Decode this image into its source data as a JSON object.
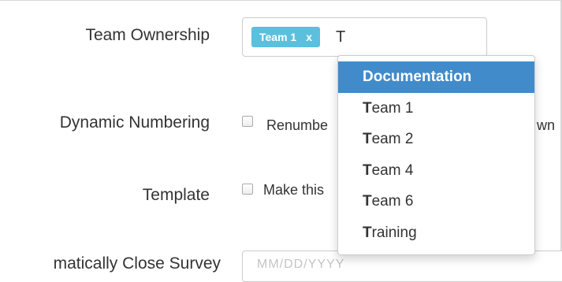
{
  "form": {
    "team_ownership": {
      "label": "Team Ownership",
      "token_label": "Team 1",
      "token_remove": "x",
      "typed_value": "T"
    },
    "dynamic_numbering": {
      "label": "Dynamic Numbering",
      "checkbox_text_left": "Renumbe",
      "checkbox_text_right": "wn",
      "checked": false
    },
    "template": {
      "label": "Template",
      "checkbox_text": "Make this",
      "checked": false
    },
    "auto_close": {
      "label": "matically Close Survey",
      "field_value": "MM/DD/YYYY"
    }
  },
  "dropdown": {
    "query": "T",
    "items": [
      {
        "label": "Documentation",
        "match": "",
        "rest": "Documentation",
        "active": true
      },
      {
        "label": "Team 1",
        "match": "T",
        "rest": "eam 1",
        "active": false
      },
      {
        "label": "Team 2",
        "match": "T",
        "rest": "eam 2",
        "active": false
      },
      {
        "label": "Team 4",
        "match": "T",
        "rest": "eam 4",
        "active": false
      },
      {
        "label": "Team 6",
        "match": "T",
        "rest": "eam 6",
        "active": false
      },
      {
        "label": "Training",
        "match": "T",
        "rest": "raining",
        "active": false
      }
    ]
  },
  "colors": {
    "token_bg": "#5bc0de",
    "active_item_bg": "#428bca",
    "text": "#333333",
    "border": "#cccccc"
  }
}
